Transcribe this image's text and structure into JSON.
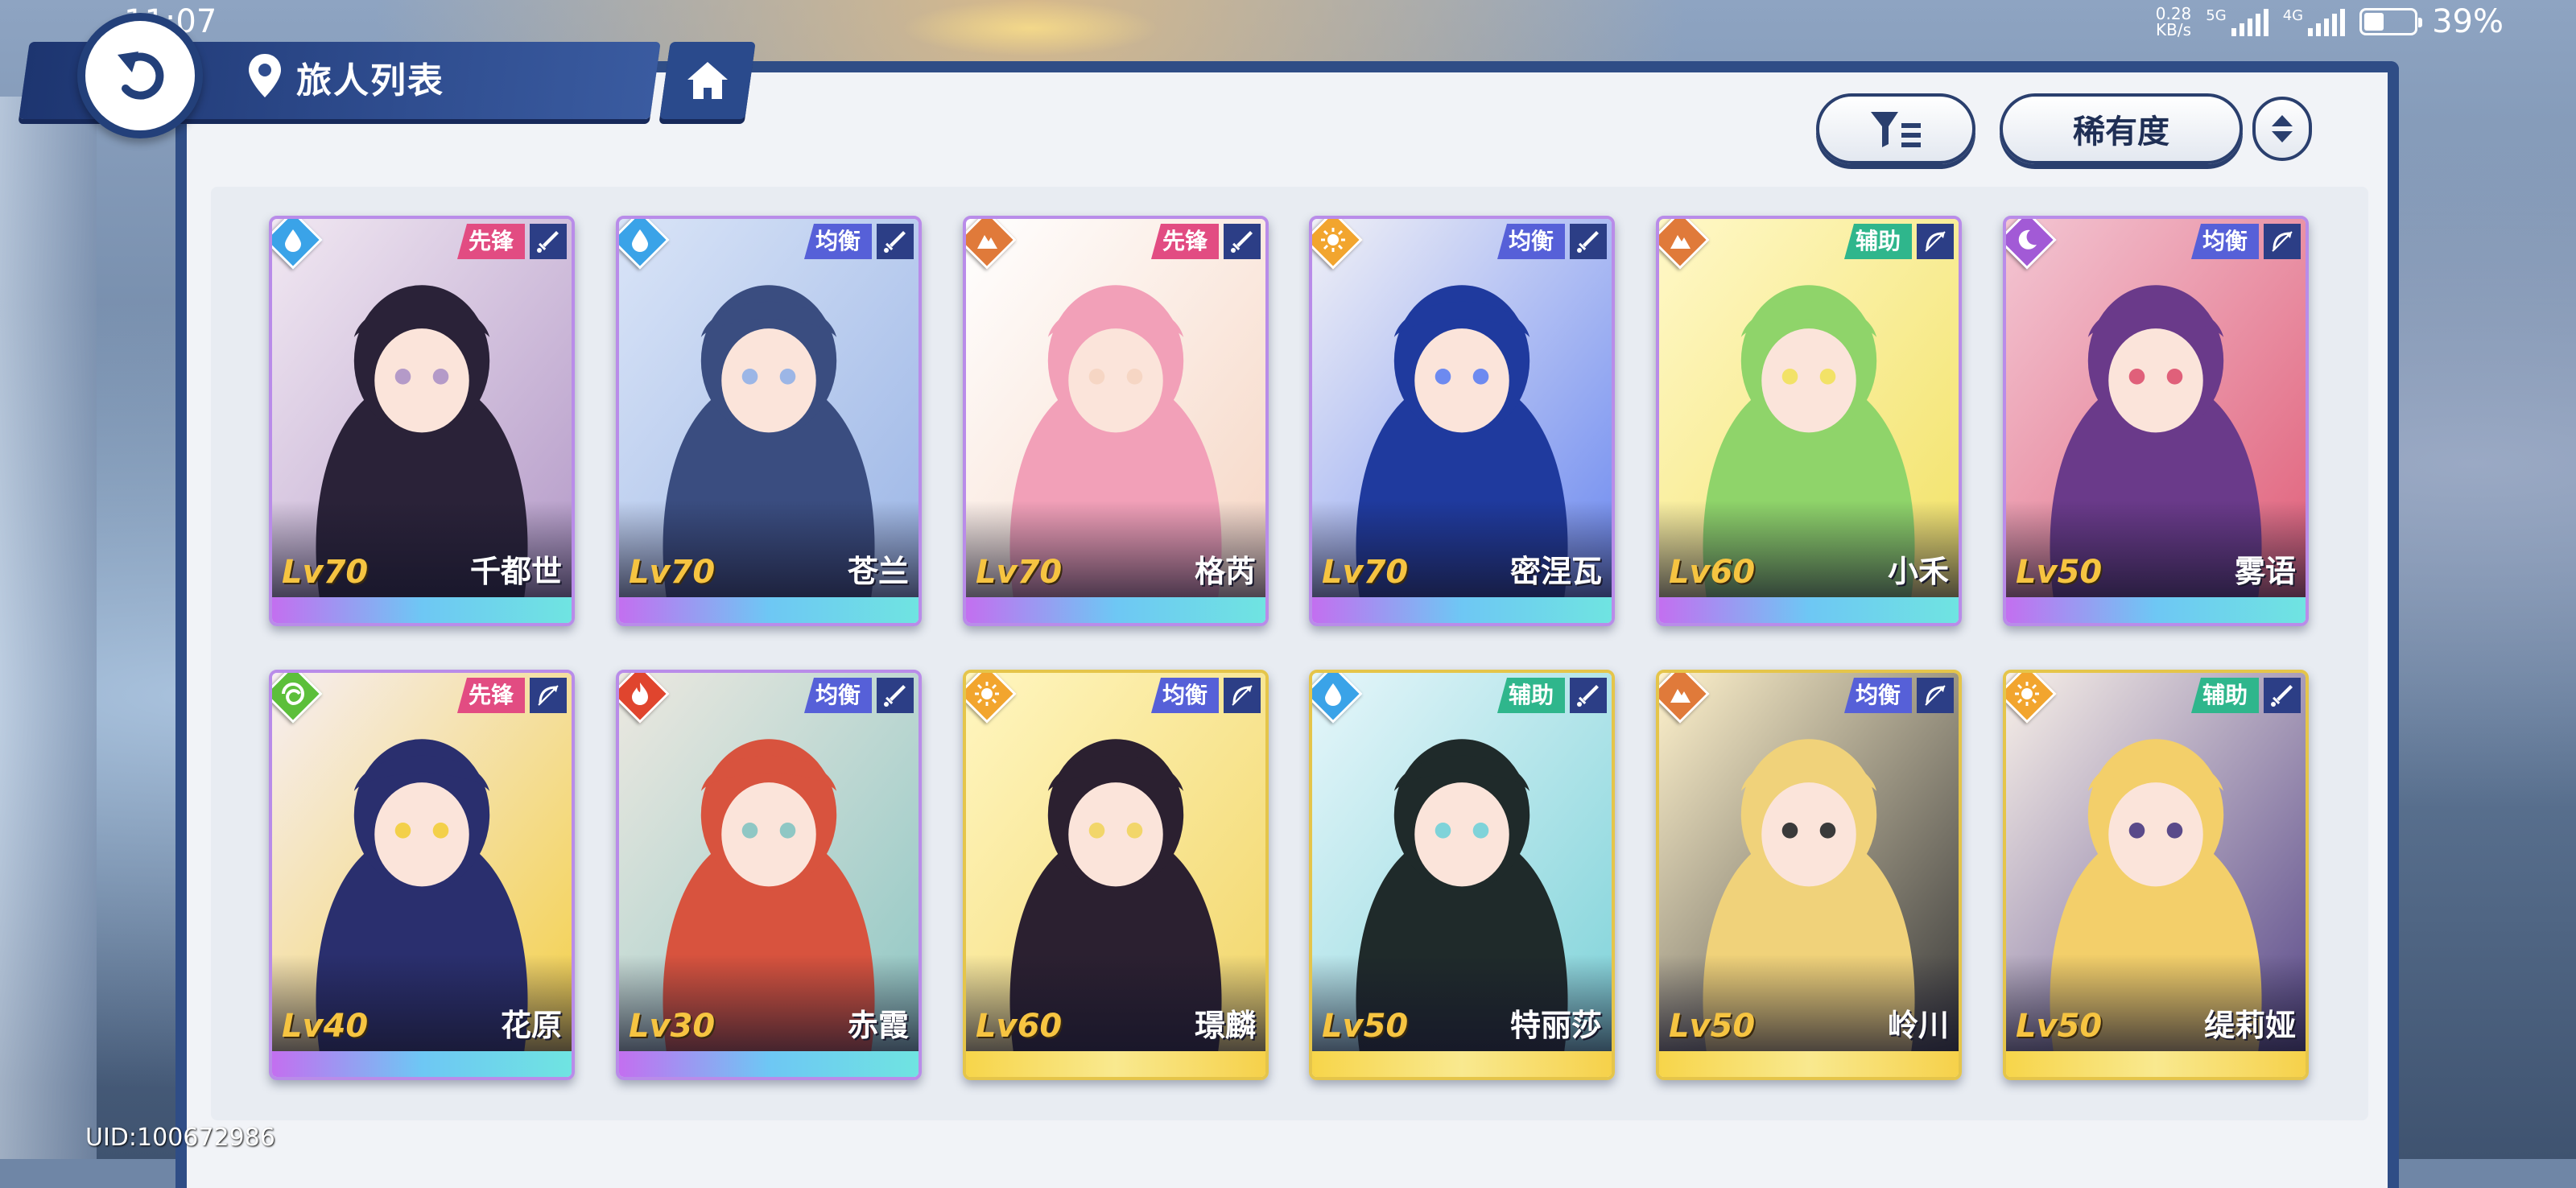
{
  "status_bar": {
    "time": "11:07",
    "net_speed_value": "0.28",
    "net_speed_unit": "KB/s",
    "network_1": "5G",
    "network_2": "4G",
    "battery": "39%"
  },
  "header": {
    "title": "旅人列表",
    "back_icon": "back-arrow-icon",
    "location_icon": "map-pin-icon",
    "home_icon": "home-icon"
  },
  "sort": {
    "filter_icon": "filter-icon",
    "sort_label": "稀有度",
    "order_icon": "sort-order-icon"
  },
  "characters": [
    {
      "name": "千都世",
      "level": "Lv70",
      "role": "先锋",
      "element": "water",
      "weapon": "sword",
      "frame": "purple"
    },
    {
      "name": "苍兰",
      "level": "Lv70",
      "role": "均衡",
      "element": "water",
      "weapon": "sword",
      "frame": "purple"
    },
    {
      "name": "格芮",
      "level": "Lv70",
      "role": "先锋",
      "element": "earth",
      "weapon": "sword",
      "frame": "purple"
    },
    {
      "name": "密涅瓦",
      "level": "Lv70",
      "role": "均衡",
      "element": "light",
      "weapon": "sword",
      "frame": "purple"
    },
    {
      "name": "小禾",
      "level": "Lv60",
      "role": "辅助",
      "element": "earth",
      "weapon": "bow",
      "frame": "purple"
    },
    {
      "name": "雾语",
      "level": "Lv50",
      "role": "均衡",
      "element": "dark",
      "weapon": "bow",
      "frame": "purple"
    },
    {
      "name": "花原",
      "level": "Lv40",
      "role": "先锋",
      "element": "wind",
      "weapon": "bow",
      "frame": "purple"
    },
    {
      "name": "赤霞",
      "level": "Lv30",
      "role": "均衡",
      "element": "fire",
      "weapon": "sword",
      "frame": "purple"
    },
    {
      "name": "璟麟",
      "level": "Lv60",
      "role": "均衡",
      "element": "light",
      "weapon": "bow",
      "frame": "gold"
    },
    {
      "name": "特丽莎",
      "level": "Lv50",
      "role": "辅助",
      "element": "water",
      "weapon": "sword",
      "frame": "gold"
    },
    {
      "name": "岭川",
      "level": "Lv50",
      "role": "均衡",
      "element": "earth",
      "weapon": "bow",
      "frame": "gold"
    },
    {
      "name": "缇莉娅",
      "level": "Lv50",
      "role": "辅助",
      "element": "light",
      "weapon": "sword",
      "frame": "gold"
    }
  ],
  "uid": "UID:100672986"
}
